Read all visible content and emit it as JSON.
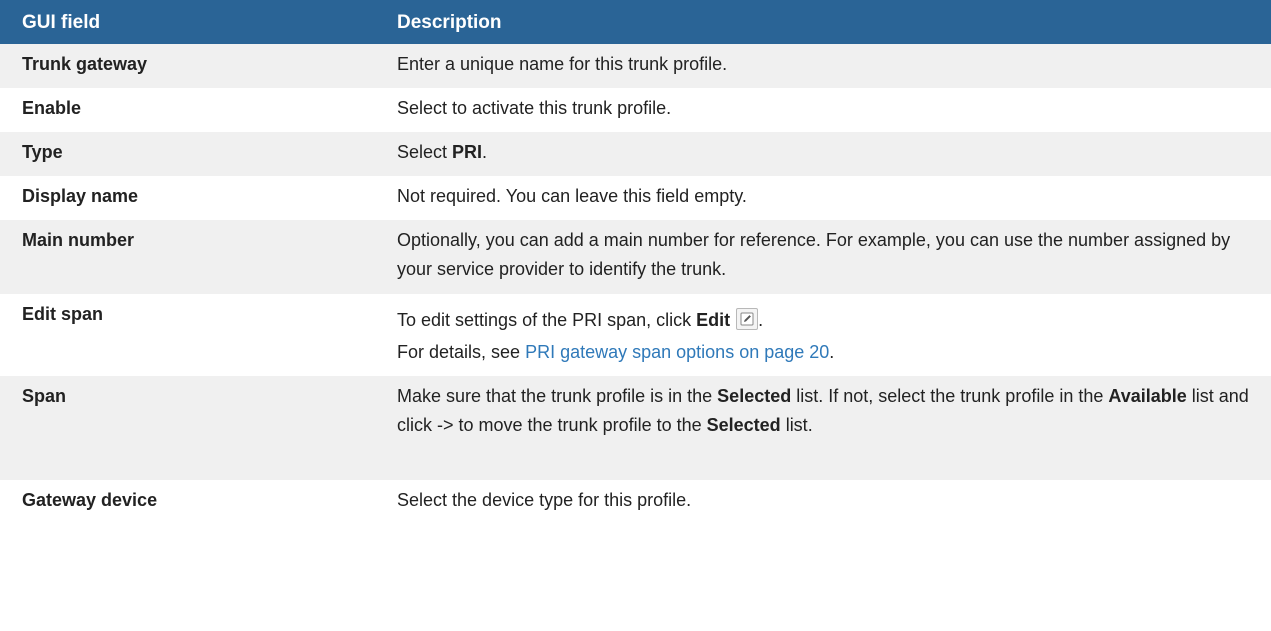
{
  "header": {
    "col1": "GUI field",
    "col2": "Description"
  },
  "rows": [
    {
      "field": "Trunk gateway",
      "desc": "Enter a unique name for this trunk profile."
    },
    {
      "field": "Enable",
      "desc": "Select to activate this trunk profile."
    },
    {
      "field": "Type",
      "desc_prefix": "Select ",
      "desc_bold": "PRI",
      "desc_suffix": "."
    },
    {
      "field": "Display name",
      "desc": "Not required. You can leave this field empty."
    },
    {
      "field": "Main number",
      "desc": "Optionally, you can add a main number for reference. For example, you can use the number assigned by your service provider to identify the trunk."
    },
    {
      "field": "Edit span",
      "line1_prefix": "To edit settings of the PRI span, click ",
      "line1_bold": "Edit",
      "line1_suffix": ".",
      "line2_prefix": "For details, see ",
      "line2_link": "PRI gateway span options on page 20",
      "line2_suffix": ".",
      "icon": "edit-icon"
    },
    {
      "field": "Span",
      "p1": "Make sure that the trunk profile is in the ",
      "b1": "Selected",
      "p2": " list. If not, select the trunk profile in the ",
      "b2": "Available",
      "p3": " list and click -> to move the trunk profile to the ",
      "b3": "Selected",
      "p4": " list."
    },
    {
      "field": "Gateway device",
      "desc": "Select the device type for this profile."
    }
  ],
  "colors": {
    "header_bg": "#2a6496",
    "link": "#2f79b9",
    "stripe": "#f0f0f0"
  }
}
